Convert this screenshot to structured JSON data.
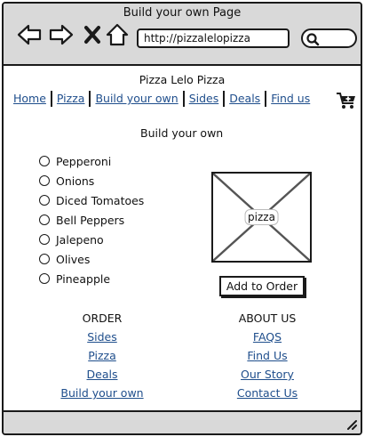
{
  "window": {
    "title": "Build your own Page"
  },
  "browser": {
    "url": "http://pizzalelopizza",
    "icons": [
      "back-arrow-icon",
      "forward-arrow-icon",
      "close-icon",
      "home-icon",
      "search-icon"
    ]
  },
  "site": {
    "title": "Pizza Lelo Pizza"
  },
  "nav": {
    "items": [
      {
        "label": "Home"
      },
      {
        "label": "Pizza"
      },
      {
        "label": "Build your own"
      },
      {
        "label": "Sides"
      },
      {
        "label": "Deals"
      },
      {
        "label": "Find us"
      }
    ],
    "cart_icon": "add-to-cart-icon"
  },
  "main": {
    "heading": "Build your own",
    "toppings": [
      {
        "label": "Pepperoni"
      },
      {
        "label": "Onions"
      },
      {
        "label": "Diced Tomatoes"
      },
      {
        "label": "Bell Peppers"
      },
      {
        "label": "Jalepeno"
      },
      {
        "label": "Olives"
      },
      {
        "label": "Pineapple"
      }
    ],
    "image_label": "pizza",
    "add_button": "Add to Order"
  },
  "footer": {
    "order": {
      "heading": "ORDER",
      "links": [
        {
          "label": "Sides"
        },
        {
          "label": "Pizza"
        },
        {
          "label": "Deals"
        },
        {
          "label": "Build your own"
        }
      ]
    },
    "about": {
      "heading": "ABOUT US",
      "links": [
        {
          "label": "FAQS"
        },
        {
          "label": "Find Us"
        },
        {
          "label": "Our Story"
        },
        {
          "label": "Contact Us"
        }
      ]
    }
  },
  "colors": {
    "chrome": "#d9d9d9",
    "link": "#1f4e8c",
    "border": "#1a1a1a"
  }
}
